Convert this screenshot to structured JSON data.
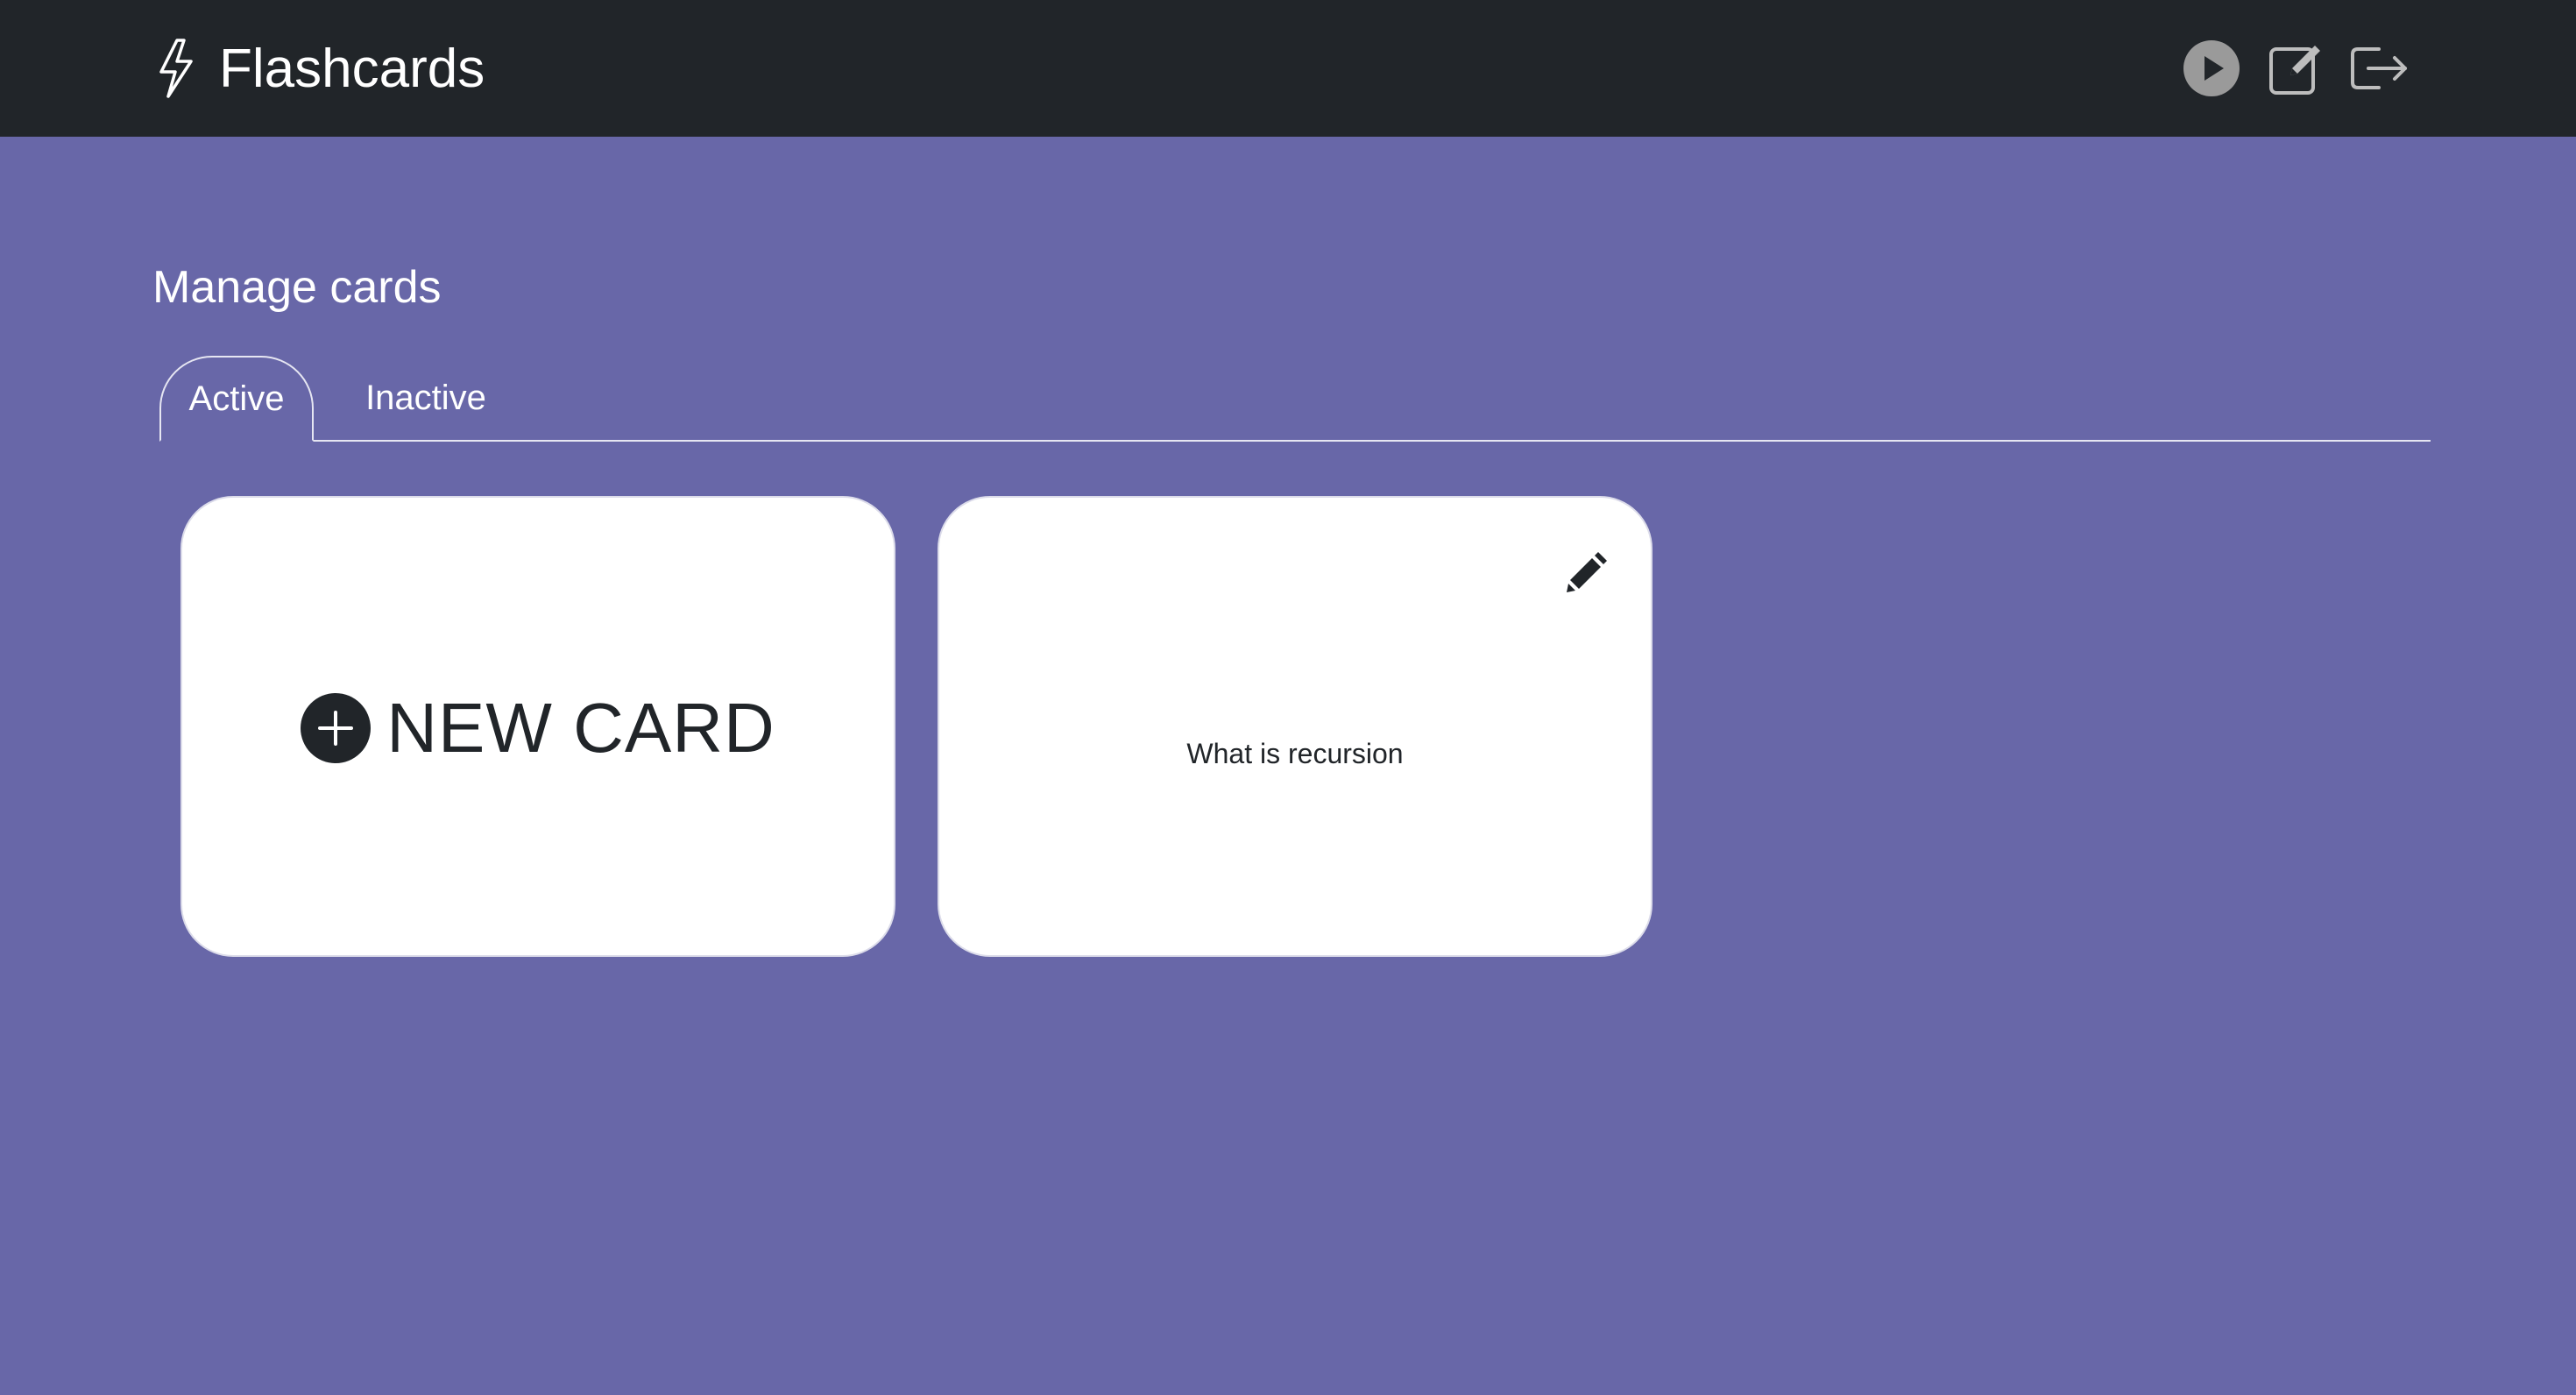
{
  "app": {
    "title": "Flashcards"
  },
  "navbar": {
    "icons": [
      "bolt-icon",
      "play-circle-icon",
      "edit-square-icon",
      "sign-out-icon"
    ],
    "colors": {
      "background": "#212529",
      "play_icon": "#9a9a9a",
      "outline_icons": "#bdbdbd"
    }
  },
  "main": {
    "page_title": "Manage cards",
    "tabs": [
      {
        "label": "Active",
        "selected": true
      },
      {
        "label": "Inactive",
        "selected": false
      }
    ],
    "new_card": {
      "label": "NEW CARD",
      "icon": "plus-circle-icon"
    },
    "cards": [
      {
        "text": "What is recursion",
        "icon": "pencil-icon"
      }
    ],
    "colors": {
      "page_background": "#6867a8",
      "card_background": "#ffffff",
      "text_dark": "#212529"
    }
  }
}
